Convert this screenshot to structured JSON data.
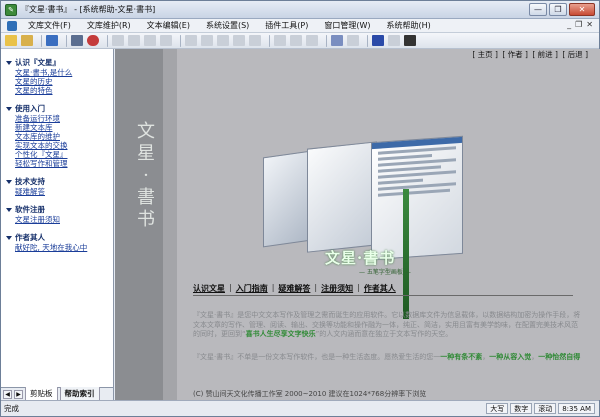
{
  "window": {
    "title": "『文星·書书』 - [系统帮助-文星·書书]",
    "buttons": {
      "minimize": "—",
      "restore": "❐",
      "close": "✕"
    }
  },
  "menubar": {
    "items": [
      "文库文件(F)",
      "文库维护(R)",
      "文本编辑(E)",
      "系统设置(S)",
      "插件工具(P)",
      "窗口管理(W)",
      "系统帮助(H)"
    ],
    "right": [
      "_",
      "❐",
      "✕"
    ]
  },
  "left": {
    "sections": [
      {
        "title": "认识『文星』",
        "links": [
          "文星·書书,是什么",
          "文星的历史",
          "文星的特色"
        ]
      },
      {
        "title": "使用入门",
        "links": [
          "准备运行环境",
          "新建文本库",
          "文本库的维护",
          "实现文本的交换",
          "个性化『文星』",
          "轻松写作和管理"
        ]
      },
      {
        "title": "技术支持",
        "links": [
          "疑难解答"
        ]
      },
      {
        "title": "软件注册",
        "links": [
          "文星注册须知"
        ]
      },
      {
        "title": "作者其人",
        "links": [
          "献好陀, 天地在我心中"
        ]
      }
    ],
    "tabs": [
      "剪贴板",
      "帮助索引"
    ]
  },
  "content": {
    "top_links": [
      "[ 主页 ]",
      "[ 作者 ]",
      "[ 前进 ]",
      "[ 后退 ]"
    ],
    "calligraphy": "文星·書书",
    "logo_text": "文星·書书",
    "logo_sub": "— 五笔字型画板 —",
    "nav": [
      "认识文星",
      "入门指南",
      "疑难解答",
      "注册须知",
      "作者其人"
    ],
    "para1_a": "『文星·書书』是您中文文本写作及管理之需而诞生的应用软件。它以数据库文件为信息载体，以数据结构加密为操作手段，将文本文章的写作、管理、阅读、输出、交换等功能和操作融为一体，纯正、简洁，实用且富有美学韵味，在配置完美技术风范的同时，更回到“",
    "para1_hl": "喜书人生尽享文字快乐",
    "para1_b": "”的人文内涵而意在独立于文本写作的天空。",
    "para2_a": "『文星·書书』不单是一份文本写作软件，也是一种生活态度。愿热爱生活的您一",
    "para2_hl1": "一种有条不紊",
    "para2_sep": "，",
    "para2_hl2": "一种从容入觉",
    "para2_hl3": "一种怡然自得",
    "footer": "(C) 赞山间天文化传播工作室 2000~2010  建议在1024*768分辨率下浏览"
  },
  "status": {
    "left": "完成",
    "right": [
      "大写",
      "数字",
      "滚动",
      "8:35 AM"
    ]
  },
  "colors": {
    "accent": "#2f8a35",
    "link": "#1a3d99",
    "title": "#16306b"
  }
}
